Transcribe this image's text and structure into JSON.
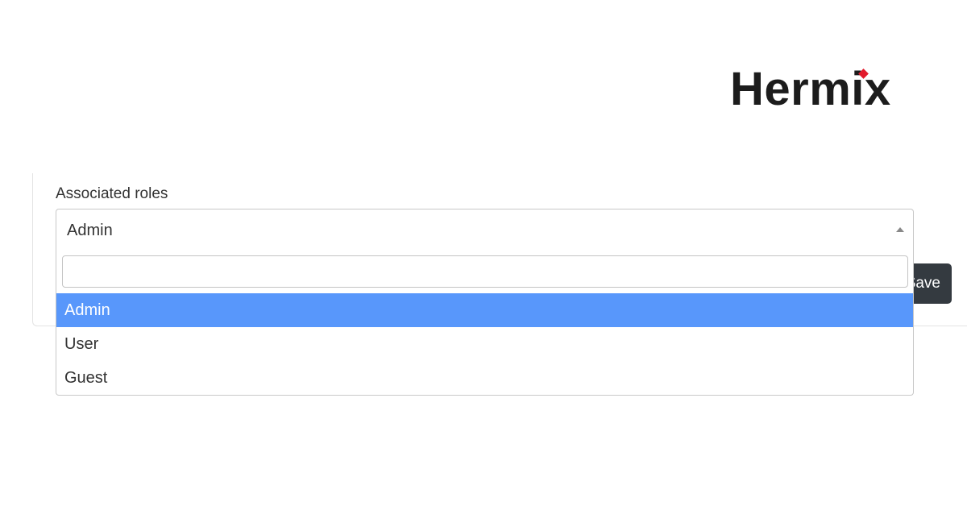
{
  "brand": {
    "name": "Hermix",
    "accent_color": "#e21b2c"
  },
  "form": {
    "roles_label": "Associated roles",
    "selected_role": "Admin",
    "save_label": "Save"
  },
  "dropdown": {
    "search_value": "",
    "highlight_color": "#5897fb",
    "options": [
      "Admin",
      "User",
      "Guest"
    ]
  }
}
